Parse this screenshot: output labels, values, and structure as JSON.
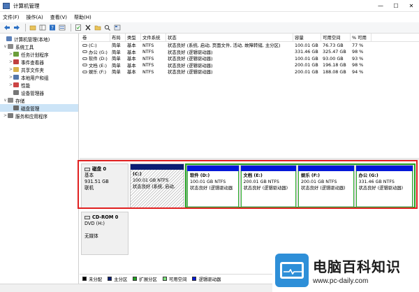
{
  "window": {
    "title": "计算机管理",
    "minimize": "—",
    "maximize": "☐",
    "close": "✕"
  },
  "menu": {
    "items": [
      "文件(F)",
      "操作(A)",
      "查看(V)",
      "帮助(H)"
    ]
  },
  "toolbar": {
    "icons": [
      "back-icon",
      "forward-icon",
      "up-folder-icon",
      "show-tree-icon",
      "help-icon",
      "view-icon",
      "properties-icon",
      "delete-icon",
      "folder-open-icon",
      "magnify-icon",
      "refresh-icon"
    ]
  },
  "tree": {
    "items": [
      {
        "label": "计算机管理(本地)",
        "arrow": "",
        "indent": 0,
        "color": "#5a7fb8",
        "selected": false
      },
      {
        "label": "系统工具",
        "arrow": "∨",
        "indent": 1,
        "color": "#8a8a8a",
        "selected": false
      },
      {
        "label": "任务计划程序",
        "arrow": ">",
        "indent": 2,
        "color": "#6b9e3a",
        "selected": false
      },
      {
        "label": "事件查看器",
        "arrow": ">",
        "indent": 2,
        "color": "#c04040",
        "selected": false
      },
      {
        "label": "共享文件夹",
        "arrow": ">",
        "indent": 2,
        "color": "#d8b24a",
        "selected": false
      },
      {
        "label": "本地用户和组",
        "arrow": ">",
        "indent": 2,
        "color": "#5577aa",
        "selected": false
      },
      {
        "label": "性能",
        "arrow": ">",
        "indent": 2,
        "color": "#cc4444",
        "selected": false
      },
      {
        "label": "设备管理器",
        "arrow": "",
        "indent": 2,
        "color": "#777777",
        "selected": false
      },
      {
        "label": "存储",
        "arrow": "∨",
        "indent": 1,
        "color": "#8a8a8a",
        "selected": false
      },
      {
        "label": "磁盘管理",
        "arrow": "",
        "indent": 2,
        "color": "#6a6a6a",
        "selected": true
      },
      {
        "label": "服务和应用程序",
        "arrow": ">",
        "indent": 1,
        "color": "#7a7a7a",
        "selected": false
      }
    ]
  },
  "volumes": {
    "headers": [
      "卷",
      "布局",
      "类型",
      "文件系统",
      "状态",
      "容量",
      "可用空间",
      "% 可用"
    ],
    "rows": [
      [
        "(C:)",
        "简单",
        "基本",
        "NTFS",
        "状态良好 (系统, 启动, 页面文件, 活动, 故障转储, 主分区)",
        "100.01 GB",
        "76.73 GB",
        "77 %"
      ],
      [
        "办公 (G:)",
        "简单",
        "基本",
        "NTFS",
        "状态良好 (逻辑驱动器)",
        "331.46 GB",
        "325.47 GB",
        "98 %"
      ],
      [
        "软件 (D:)",
        "简单",
        "基本",
        "NTFS",
        "状态良好 (逻辑驱动器)",
        "100.01 GB",
        "93.00 GB",
        "93 %"
      ],
      [
        "文档 (E:)",
        "简单",
        "基本",
        "NTFS",
        "状态良好 (逻辑驱动器)",
        "200.01 GB",
        "196.18 GB",
        "98 %"
      ],
      [
        "娱乐 (F:)",
        "简单",
        "基本",
        "NTFS",
        "状态良好 (逻辑驱动器)",
        "200.01 GB",
        "188.08 GB",
        "94 %"
      ]
    ]
  },
  "disk0": {
    "name": "磁盘 0",
    "type": "基本",
    "size": "931.51 GB",
    "state": "联机",
    "partitions": [
      {
        "name": "(C:)",
        "size": "100.01 GB NTFS",
        "status": "状态良好 (系统, 启动,",
        "kind": "primary"
      },
      {
        "name": "软件 (D:)",
        "size": "100.01 GB NTFS",
        "status": "状态良好 (逻辑驱动器",
        "kind": "logical"
      },
      {
        "name": "文档 (E:)",
        "size": "200.01 GB NTFS",
        "status": "状态良好 (逻辑驱动器)",
        "kind": "logical"
      },
      {
        "name": "娱乐 (F:)",
        "size": "200.01 GB NTFS",
        "status": "状态良好 (逻辑驱动器)",
        "kind": "logical"
      },
      {
        "name": "办公 (G:)",
        "size": "331.46 GB NTFS",
        "status": "状态良好 (逻辑驱动器)",
        "kind": "logical"
      }
    ]
  },
  "cdrom0": {
    "name": "CD-ROM 0",
    "type": "DVD (H:)",
    "state": "无媒体"
  },
  "legend": {
    "items": [
      {
        "label": "未分配",
        "color": "#000000"
      },
      {
        "label": "主分区",
        "color": "#0c1e74"
      },
      {
        "label": "扩展分区",
        "color": "#22a222"
      },
      {
        "label": "可用空间",
        "color": "#7fe37f"
      },
      {
        "label": "逻辑驱动器",
        "color": "#0018d8"
      }
    ]
  },
  "watermark": {
    "title": "电脑百科知识",
    "url": "www.pc-daily.com",
    "brand_color": "#2e8fd8"
  }
}
